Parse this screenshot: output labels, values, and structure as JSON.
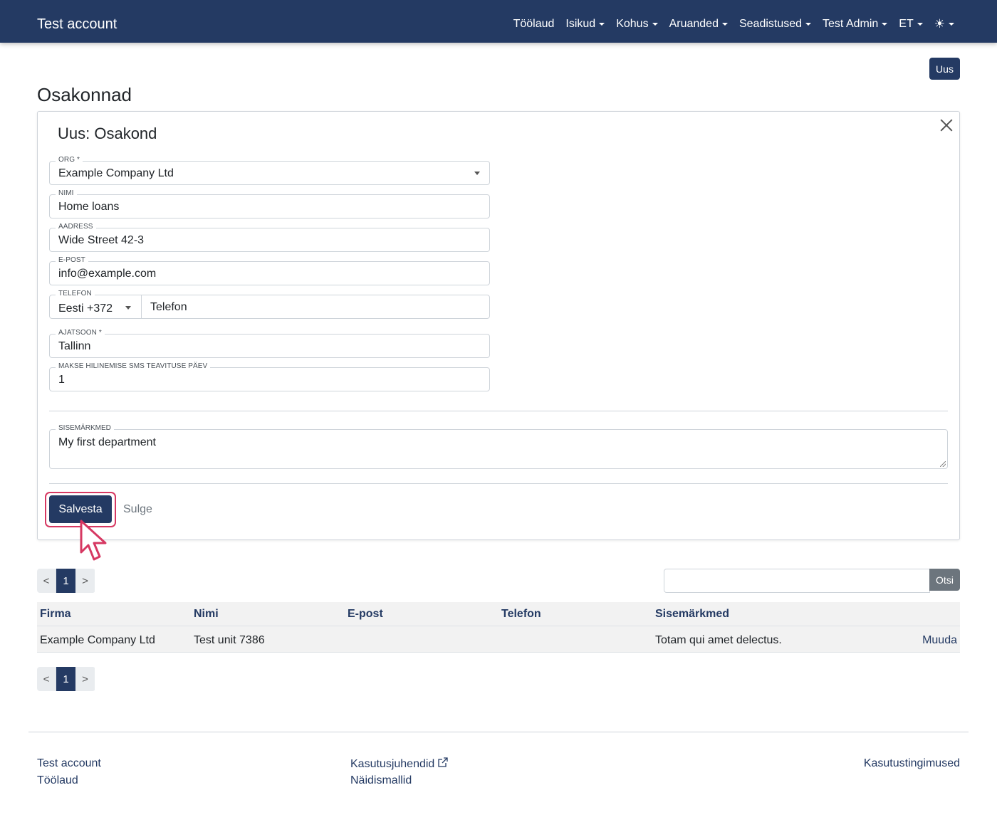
{
  "navbar": {
    "brand": "Test account",
    "items": [
      "Töölaud",
      "Isikud",
      "Kohus",
      "Aruanded",
      "Seadistused",
      "Test Admin",
      "ET"
    ],
    "theme_icon": "sun-icon"
  },
  "header": {
    "new_button": "Uus",
    "title": "Osakonnad"
  },
  "form": {
    "title": "Uus: Osakond",
    "close_icon": "close-icon",
    "org": {
      "label": "ORG *",
      "value": "Example Company Ltd"
    },
    "name": {
      "label": "NIMI",
      "value": "Home loans"
    },
    "address": {
      "label": "AADRESS",
      "value": "Wide Street 42-3"
    },
    "email": {
      "label": "E-POST",
      "value": "info@example.com"
    },
    "phone": {
      "label": "TELEFON",
      "country": "Eesti +372",
      "placeholder": "Telefon"
    },
    "timezone": {
      "label": "AJATSOON *",
      "value": "Tallinn"
    },
    "sms_day": {
      "label": "MAKSE HILINEMISE SMS TEAVITUSE PÄEV",
      "value": "1"
    },
    "notes": {
      "label": "SISEMÄRKMED",
      "value": "My first department"
    },
    "save_button": "Salvesta",
    "close_button": "Sulge"
  },
  "pagination": {
    "prev": "<",
    "current": "1",
    "next": ">"
  },
  "search": {
    "button": "Otsi",
    "value": ""
  },
  "table": {
    "columns": [
      "Firma",
      "Nimi",
      "E-post",
      "Telefon",
      "Sisemärkmed"
    ],
    "rows": [
      {
        "firma": "Example Company Ltd",
        "nimi": "Test unit 7386",
        "epost": "",
        "telefon": "",
        "sisemarkmed": "Totam qui amet delectus.",
        "action": "Muuda"
      }
    ]
  },
  "footer": {
    "col1": [
      "Test account",
      "Töölaud"
    ],
    "col2": [
      "Kasutusjuhendid",
      "Näidismallid"
    ],
    "col3": [
      "Kasutustingimused"
    ]
  },
  "colors": {
    "primary": "#243a63",
    "focus": "#d63862",
    "secondary": "#6c757d"
  }
}
